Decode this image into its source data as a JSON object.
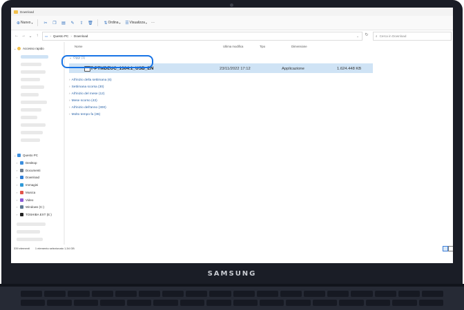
{
  "window": {
    "title": "Download"
  },
  "toolbar": {
    "new_label": "Nuovo",
    "sort_label": "Ordina",
    "view_label": "Visualizza",
    "more_label": "···"
  },
  "address": {
    "path": [
      "Questo PC",
      "Download"
    ],
    "search_placeholder": "Cerca in Download"
  },
  "navpane": {
    "quick_access": "Accesso rapido",
    "this_pc": "Questo PC",
    "items": [
      {
        "label": "Desktop",
        "color": "#3b8ede"
      },
      {
        "label": "Documenti",
        "color": "#6f7d8c"
      },
      {
        "label": "Download",
        "color": "#2f7fd8"
      },
      {
        "label": "Immagini",
        "color": "#2f9ad8"
      },
      {
        "label": "Musica",
        "color": "#e2544a"
      },
      {
        "label": "Video",
        "color": "#8a5bd6"
      },
      {
        "label": "Windows (C:)",
        "color": "#5d7893"
      },
      {
        "label": "TOSHIBA EXT (E:)",
        "color": "#222222"
      }
    ]
  },
  "columns": {
    "name": "Nome",
    "date": "Ultima modifica",
    "type": "Tipo",
    "size": "Dimensione"
  },
  "groups": {
    "today": "Oggi (1)",
    "this_week": "All'inizio della settimana (6)",
    "last_week": "Settimana scorsa (30)",
    "this_month": "All'inizio del mese (12)",
    "last_month": "Mese scorso (43)",
    "this_year": "All'inizio dell'anno (300)",
    "long_ago": "Molto tempo fa (36)"
  },
  "file": {
    "name": "T-PTMDEUC_1304.1_USB_EN",
    "date": "23/11/2022 17:12",
    "type": "Applicazione",
    "size": "1.624.448 KB"
  },
  "status": {
    "count": "339 elementi",
    "selection": "1 elemento selezionato 1,54 GB"
  },
  "brand": "SAMSUNG"
}
